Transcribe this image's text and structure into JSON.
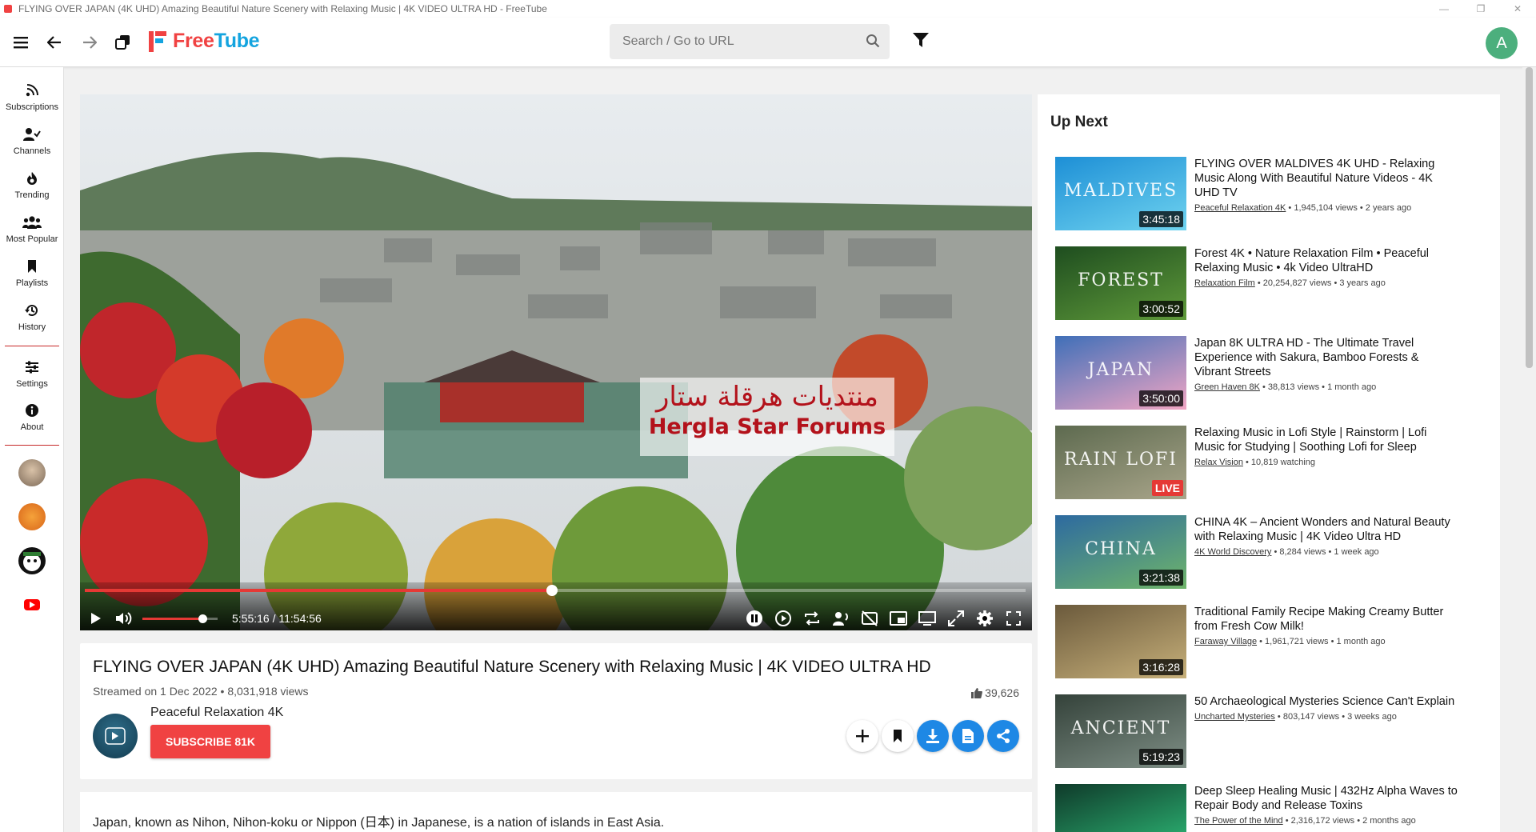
{
  "window": {
    "title": "FLYING OVER JAPAN (4K UHD) Amazing Beautiful Nature Scenery with Relaxing Music | 4K VIDEO ULTRA HD - FreeTube"
  },
  "topnav": {
    "logo_free": "Free",
    "logo_tube": "Tube",
    "search_placeholder": "Search / Go to URL",
    "avatar_letter": "A"
  },
  "sidenav": {
    "items": [
      {
        "label": "Subscriptions",
        "icon": "rss-icon"
      },
      {
        "label": "Channels",
        "icon": "user-check-icon"
      },
      {
        "label": "Trending",
        "icon": "fire-icon"
      },
      {
        "label": "Most Popular",
        "icon": "users-icon"
      },
      {
        "label": "Playlists",
        "icon": "bookmark-icon"
      },
      {
        "label": "History",
        "icon": "history-icon"
      },
      {
        "label": "Settings",
        "icon": "sliders-icon"
      },
      {
        "label": "About",
        "icon": "info-icon"
      }
    ]
  },
  "player": {
    "watermark_ar": "منتديات هرقلة ستار",
    "watermark_en": "Hergla Star Forums",
    "time": "5:55:16 / 11:54:56",
    "progress": 0.497,
    "volume": 0.8
  },
  "video": {
    "title": "FLYING OVER JAPAN (4K UHD) Amazing Beautiful Nature Scenery with Relaxing Music | 4K VIDEO ULTRA HD",
    "meta": "Streamed on 1 Dec 2022 • 8,031,918 views",
    "likes": "39,626",
    "channel": "Peaceful Relaxation 4K",
    "subscribe": "SUBSCRIBE 81K",
    "description": "Japan, known as Nihon, Nihon-koku or Nippon (日本) in Japanese, is a nation of islands in East Asia."
  },
  "upnext": {
    "title": "Up Next",
    "items": [
      {
        "title": "FLYING OVER MALDIVES 4K UHD - Relaxing Music Along With Beautiful Nature Videos - 4K UHD TV",
        "channel": "Peaceful Relaxation 4K",
        "stats": " • 1,945,104 views • 2 years ago",
        "duration": "3:45:18",
        "thumb_word": "MALDIVES",
        "c1": "#1d8fd6",
        "c2": "#6fd3ef"
      },
      {
        "title": "Forest 4K • Nature Relaxation Film • Peaceful Relaxing Music • 4k Video UltraHD",
        "channel": "Relaxation Film",
        "stats": " • 20,254,827 views • 3 years ago",
        "duration": "3:00:52",
        "thumb_word": "FOREST",
        "c1": "#1e4d1f",
        "c2": "#5f9a3a"
      },
      {
        "title": "Japan 8K ULTRA HD - The Ultimate Travel Experience with Sakura, Bamboo Forests & Vibrant Streets",
        "channel": "Green Haven 8K",
        "stats": " • 38,813 views • 1 month ago",
        "duration": "3:50:00",
        "thumb_word": "JAPAN",
        "c1": "#3f6fb8",
        "c2": "#f2a6c4"
      },
      {
        "title": "Relaxing Music in Lofi Style | Rainstorm | Lofi Music for Studying | Soothing Lofi for Sleep",
        "channel": "Relax Vision",
        "stats": " • 10,819 watching",
        "duration": "LIVE",
        "thumb_word": "RAIN LOFI",
        "c1": "#5d6a4f",
        "c2": "#a9a58a"
      },
      {
        "title": "CHINA 4K – Ancient Wonders and Natural Beauty with Relaxing Music | 4K Video Ultra HD",
        "channel": "4K World Discovery",
        "stats": " • 8,284 views • 1 week ago",
        "duration": "3:21:38",
        "thumb_word": "CHINA",
        "c1": "#2d6aa0",
        "c2": "#6fb56a"
      },
      {
        "title": "Traditional Family Recipe Making Creamy Butter from Fresh Cow Milk!",
        "channel": "Faraway Village",
        "stats": " • 1,961,721 views • 1 month ago",
        "duration": "3:16:28",
        "thumb_word": "",
        "c1": "#6b5a3c",
        "c2": "#c7b07a"
      },
      {
        "title": "50 Archaeological Mysteries Science Can't Explain",
        "channel": "Uncharted Mysteries",
        "stats": " • 803,147 views • 3 weeks ago",
        "duration": "5:19:23",
        "thumb_word": "ANCIENT",
        "c1": "#34423a",
        "c2": "#7f8f86"
      },
      {
        "title": "Deep Sleep Healing Music | 432Hz Alpha Waves to Repair Body and Release Toxins",
        "channel": "The Power of the Mind",
        "stats": " • 2,316,172 views • 2 months ago",
        "duration": "",
        "thumb_word": "",
        "c1": "#0f3a2a",
        "c2": "#2fbf7a"
      }
    ]
  }
}
